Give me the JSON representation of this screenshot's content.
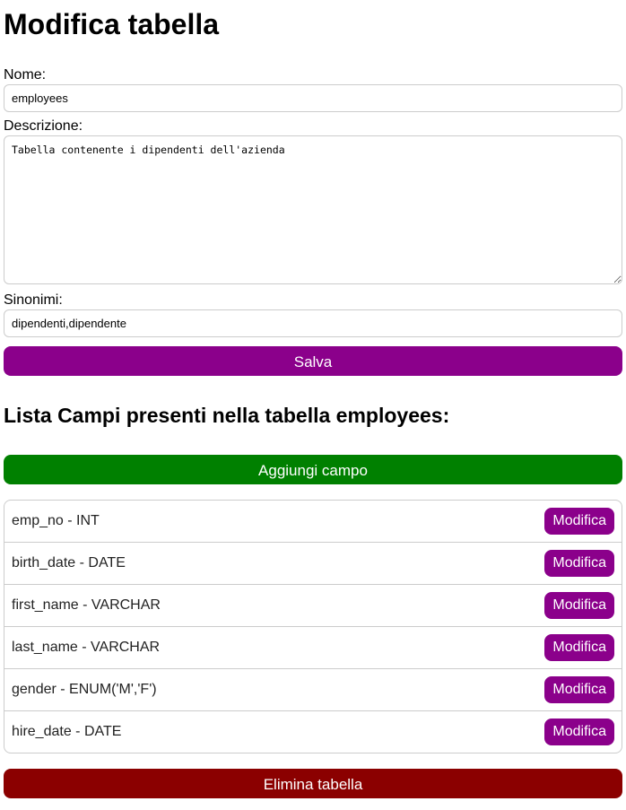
{
  "page": {
    "title": "Modifica tabella"
  },
  "form": {
    "name_label": "Nome:",
    "name_value": "employees",
    "description_label": "Descrizione:",
    "description_value": "Tabella contenente i dipendenti dell'azienda",
    "synonyms_label": "Sinonimi:",
    "synonyms_value": "dipendenti,dipendente",
    "save_label": "Salva"
  },
  "fields_section": {
    "heading": "Lista Campi presenti nella tabella employees:",
    "add_label": "Aggiungi campo",
    "edit_label": "Modifica",
    "items": [
      {
        "label": "emp_no - INT"
      },
      {
        "label": "birth_date - DATE"
      },
      {
        "label": "first_name - VARCHAR"
      },
      {
        "label": "last_name - VARCHAR"
      },
      {
        "label": "gender - ENUM('M','F')"
      },
      {
        "label": "hire_date - DATE"
      }
    ]
  },
  "delete_label": "Elimina tabella",
  "colors": {
    "save": "#8b008b",
    "add": "#008000",
    "edit": "#8b008b",
    "delete": "#8b0000"
  }
}
